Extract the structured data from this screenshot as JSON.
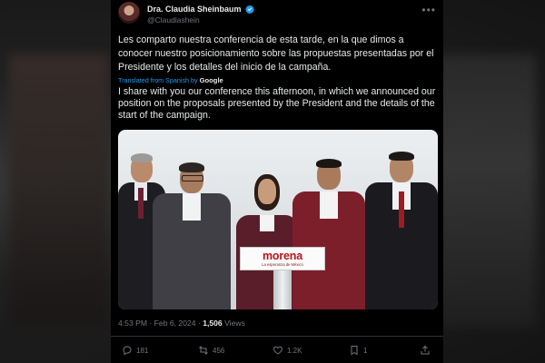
{
  "author": {
    "name": "Dra. Claudia Sheinbaum",
    "handle": "@Claudiashein"
  },
  "tweet": {
    "text_es": "Les comparto nuestra conferencia de esta tarde, en la que dimos a conocer nuestro posicionamiento sobre las propuestas presentadas por el Presidente y los detalles del inicio de la campaña.",
    "translated_label": "Translated from Spanish by",
    "translator": "Google",
    "text_en": "I share with you our conference this afternoon, in which we announced our position on the proposals presented by the President and the details of the start of the campaign."
  },
  "photo": {
    "podium_logo": "morena",
    "podium_tagline": "La esperanza de México"
  },
  "meta": {
    "time": "4:53 PM",
    "separator": "·",
    "date": "Feb 6, 2024",
    "views_count": "1,506",
    "views_label": "Views"
  },
  "actions": {
    "replies": "181",
    "reposts": "456",
    "likes": "1.2K",
    "bookmarks": "1"
  },
  "colors": {
    "background": "#000000",
    "text": "#e7e9ea",
    "muted": "#71767b",
    "link": "#1d9bf0",
    "verified": "#1d9bf0",
    "morena_red": "#b5171b"
  }
}
